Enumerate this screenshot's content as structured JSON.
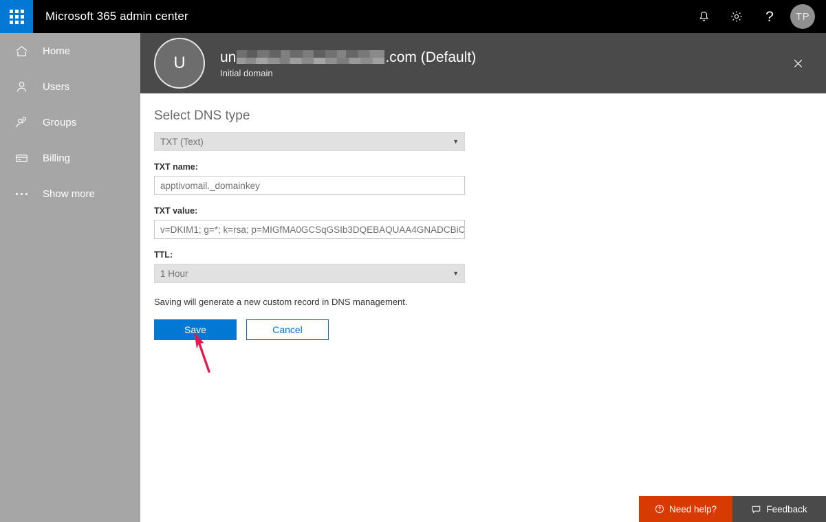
{
  "suite_bar": {
    "app_launcher_label": "App launcher",
    "title": "Microsoft 365 admin center",
    "notifications_icon": "bell-icon",
    "settings_icon": "gear-icon",
    "help_icon": "question-mark-icon",
    "help_glyph": "?",
    "avatar_initials": "TP",
    "background_color": "#000000",
    "launcher_color": "#0078d4"
  },
  "sidebar": {
    "background_color": "#a6a6a6",
    "items": [
      {
        "label": "Home",
        "icon": "home-icon"
      },
      {
        "label": "Users",
        "icon": "user-icon"
      },
      {
        "label": "Groups",
        "icon": "groups-icon"
      },
      {
        "label": "Billing",
        "icon": "credit-card-icon"
      },
      {
        "label": "Show more",
        "icon": "ellipsis-icon"
      }
    ]
  },
  "panel": {
    "header": {
      "avatar_initial": "U",
      "title_prefix": "un",
      "title_redacted": true,
      "title_suffix": ".com (Default)",
      "subtitle": "Initial domain",
      "close_icon": "close-icon",
      "background_color": "#4a4a4a"
    },
    "form": {
      "heading": "Select DNS type",
      "dns_type": {
        "label": "",
        "value": "TXT (Text)",
        "disabled": true,
        "caret": "▼"
      },
      "txt_name": {
        "label": "TXT name:",
        "value": "apptivomail._domainkey"
      },
      "txt_value": {
        "label": "TXT value:",
        "value": "v=DKIM1; g=*; k=rsa; p=MIGfMA0GCSqGSIb3DQEBAQUAA4GNADCBiC"
      },
      "ttl": {
        "label": "TTL:",
        "value": "1 Hour",
        "disabled": true,
        "caret": "▼"
      },
      "hint": "Saving will generate a new custom record in DNS management.",
      "save_label": "Save",
      "cancel_label": "Cancel",
      "primary_color": "#0078d4"
    }
  },
  "annotation": {
    "arrow_color": "#e8174a",
    "points_to": "save-button"
  },
  "bottom_bar": {
    "need_help_label": "Need help?",
    "need_help_icon": "question-circle-icon",
    "need_help_color": "#d83b01",
    "feedback_label": "Feedback",
    "feedback_icon": "speech-bubble-icon",
    "feedback_color": "#4a4a4a"
  }
}
